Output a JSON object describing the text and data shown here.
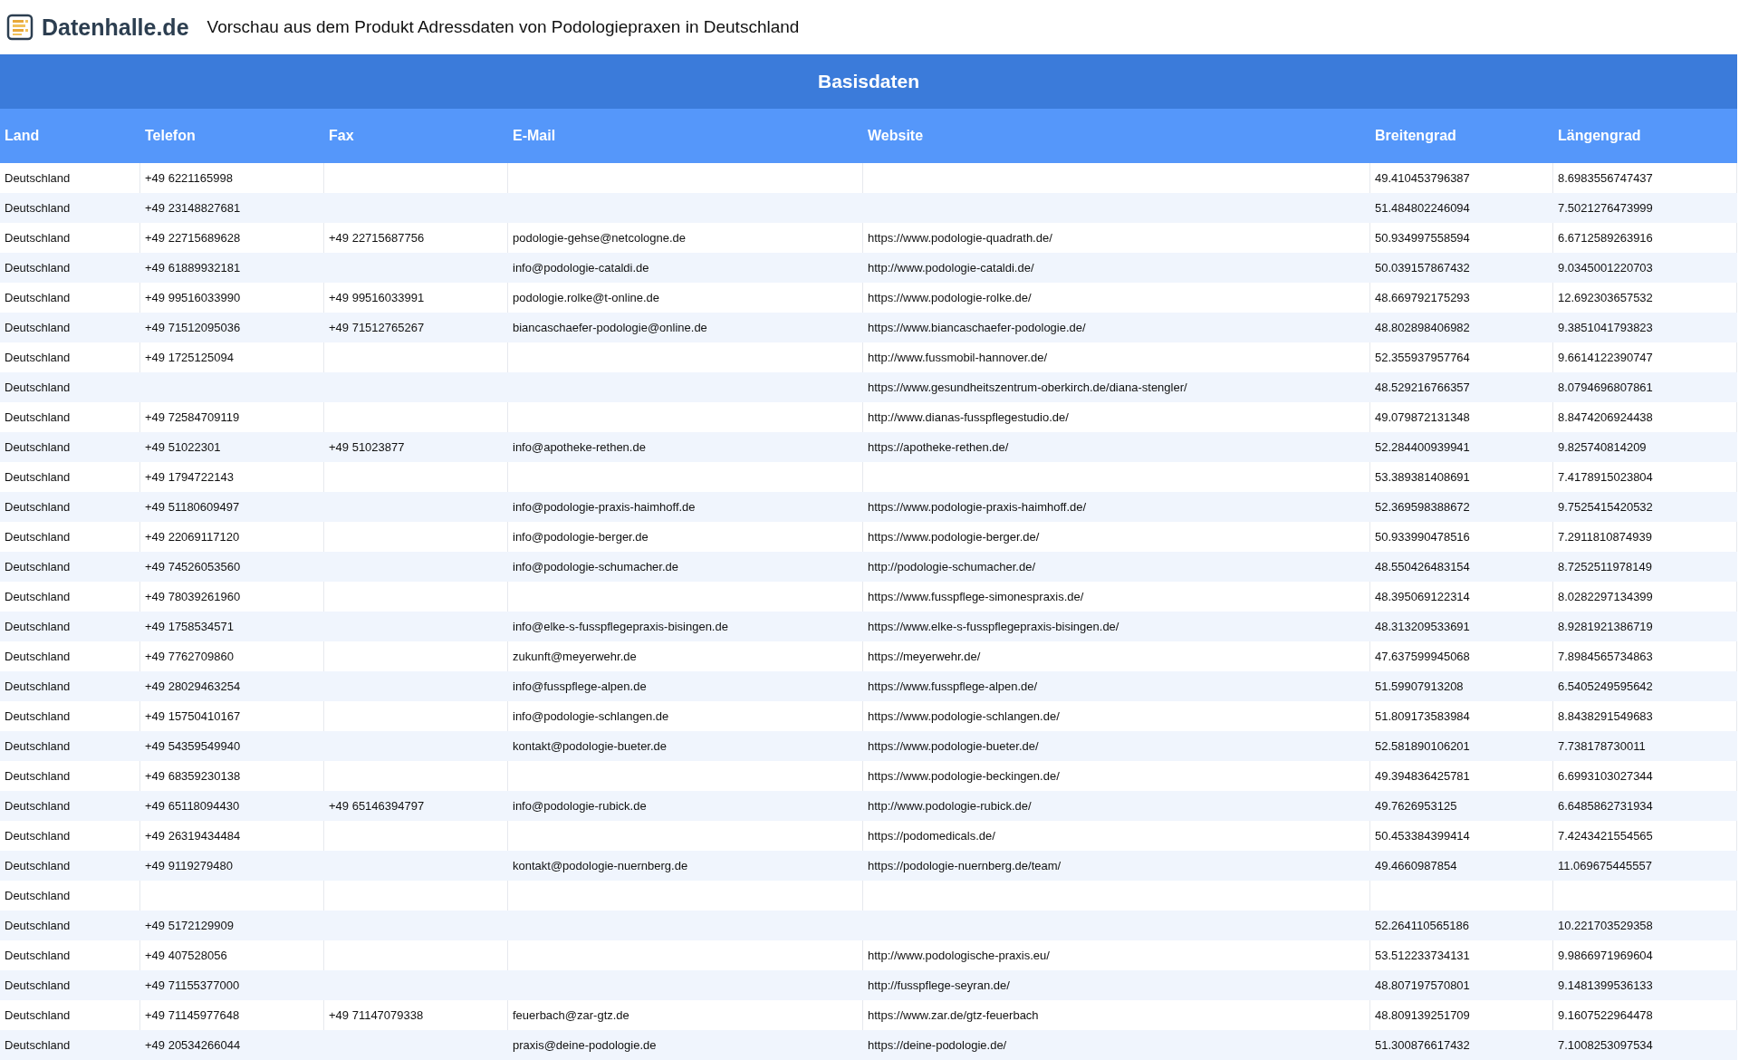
{
  "header": {
    "logo_text": "Datenhalle.de",
    "title": "Vorschau aus dem Produkt Adressdaten von Podologiepraxen in Deutschland"
  },
  "table": {
    "caption": "Basisdaten",
    "columns": [
      "Land",
      "Telefon",
      "Fax",
      "E-Mail",
      "Website",
      "Breitengrad",
      "Längengrad"
    ],
    "rows": [
      [
        "Deutschland",
        "+49 6221165998",
        null,
        null,
        null,
        "49.410453796387",
        "8.6983556747437"
      ],
      [
        "Deutschland",
        "+49 23148827681",
        null,
        null,
        null,
        "51.484802246094",
        "7.5021276473999"
      ],
      [
        "Deutschland",
        "+49 22715689628",
        "+49 22715687756",
        "podologie-gehse@netcologne.de",
        "https://www.podologie-quadrath.de/",
        "50.934997558594",
        "6.6712589263916"
      ],
      [
        "Deutschland",
        "+49 61889932181",
        null,
        "info@podologie-cataldi.de",
        "http://www.podologie-cataldi.de/",
        "50.039157867432",
        "9.0345001220703"
      ],
      [
        "Deutschland",
        "+49 99516033990",
        "+49 99516033991",
        "podologie.rolke@t-online.de",
        "https://www.podologie-rolke.de/",
        "48.669792175293",
        "12.692303657532"
      ],
      [
        "Deutschland",
        "+49 71512095036",
        "+49 71512765267",
        "biancaschaefer-podologie@online.de",
        "https://www.biancaschaefer-podologie.de/",
        "48.802898406982",
        "9.3851041793823"
      ],
      [
        "Deutschland",
        "+49 1725125094",
        null,
        null,
        "http://www.fussmobil-hannover.de/",
        "52.355937957764",
        "9.6614122390747"
      ],
      [
        "Deutschland",
        null,
        null,
        null,
        "https://www.gesundheitszentrum-oberkirch.de/diana-stengler/",
        "48.529216766357",
        "8.0794696807861"
      ],
      [
        "Deutschland",
        "+49 72584709119",
        null,
        null,
        "http://www.dianas-fusspflegestudio.de/",
        "49.079872131348",
        "8.8474206924438"
      ],
      [
        "Deutschland",
        "+49 51022301",
        "+49 51023877",
        "info@apotheke-rethen.de",
        "https://apotheke-rethen.de/",
        "52.284400939941",
        "9.825740814209"
      ],
      [
        "Deutschland",
        "+49 1794722143",
        null,
        null,
        null,
        "53.389381408691",
        "7.4178915023804"
      ],
      [
        "Deutschland",
        "+49 51180609497",
        null,
        "info@podologie-praxis-haimhoff.de",
        "https://www.podologie-praxis-haimhoff.de/",
        "52.369598388672",
        "9.7525415420532"
      ],
      [
        "Deutschland",
        "+49 22069117120",
        null,
        "info@podologie-berger.de",
        "https://www.podologie-berger.de/",
        "50.933990478516",
        "7.2911810874939"
      ],
      [
        "Deutschland",
        "+49 74526053560",
        null,
        "info@podologie-schumacher.de",
        "http://podologie-schumacher.de/",
        "48.550426483154",
        "8.7252511978149"
      ],
      [
        "Deutschland",
        "+49 78039261960",
        null,
        null,
        "https://www.fusspflege-simonespraxis.de/",
        "48.395069122314",
        "8.0282297134399"
      ],
      [
        "Deutschland",
        "+49 1758534571",
        null,
        "info@elke-s-fusspflegepraxis-bisingen.de",
        "https://www.elke-s-fusspflegepraxis-bisingen.de/",
        "48.313209533691",
        "8.9281921386719"
      ],
      [
        "Deutschland",
        "+49 7762709860",
        null,
        "zukunft@meyerwehr.de",
        "https://meyerwehr.de/",
        "47.637599945068",
        "7.8984565734863"
      ],
      [
        "Deutschland",
        "+49 28029463254",
        null,
        "info@fusspflege-alpen.de",
        "https://www.fusspflege-alpen.de/",
        "51.59907913208",
        "6.5405249595642"
      ],
      [
        "Deutschland",
        "+49 15750410167",
        null,
        "info@podologie-schlangen.de",
        "https://www.podologie-schlangen.de/",
        "51.809173583984",
        "8.8438291549683"
      ],
      [
        "Deutschland",
        "+49 54359549940",
        null,
        "kontakt@podologie-bueter.de",
        "https://www.podologie-bueter.de/",
        "52.581890106201",
        "7.738178730011"
      ],
      [
        "Deutschland",
        "+49 68359230138",
        null,
        null,
        "https://www.podologie-beckingen.de/",
        "49.394836425781",
        "6.6993103027344"
      ],
      [
        "Deutschland",
        "+49 65118094430",
        "+49 65146394797",
        "info@podologie-rubick.de",
        "http://www.podologie-rubick.de/",
        "49.7626953125",
        "6.6485862731934"
      ],
      [
        "Deutschland",
        "+49 26319434484",
        null,
        null,
        "https://podomedicals.de/",
        "50.453384399414",
        "7.4243421554565"
      ],
      [
        "Deutschland",
        "+49 9119279480",
        null,
        "kontakt@podologie-nuernberg.de",
        "https://podologie-nuernberg.de/team/",
        "49.4660987854",
        "11.069675445557"
      ],
      [
        "Deutschland",
        null,
        null,
        null,
        null,
        null,
        null
      ],
      [
        "Deutschland",
        "+49 5172129909",
        null,
        null,
        null,
        "52.264110565186",
        "10.221703529358"
      ],
      [
        "Deutschland",
        "+49 407528056",
        null,
        null,
        "http://www.podologische-praxis.eu/",
        "53.512233734131",
        "9.9866971969604"
      ],
      [
        "Deutschland",
        "+49 71155377000",
        null,
        null,
        "http://fusspflege-seyran.de/",
        "48.807197570801",
        "9.1481399536133"
      ],
      [
        "Deutschland",
        "+49 71145977648",
        "+49 71147079338",
        "feuerbach@zar-gtz.de",
        "https://www.zar.de/gtz-feuerbach",
        "48.809139251709",
        "9.1607522964478"
      ],
      [
        "Deutschland",
        "+49 20534266044",
        null,
        "praxis@deine-podologie.de",
        "https://deine-podologie.de/",
        "51.300876617432",
        "7.1008253097534"
      ]
    ]
  }
}
